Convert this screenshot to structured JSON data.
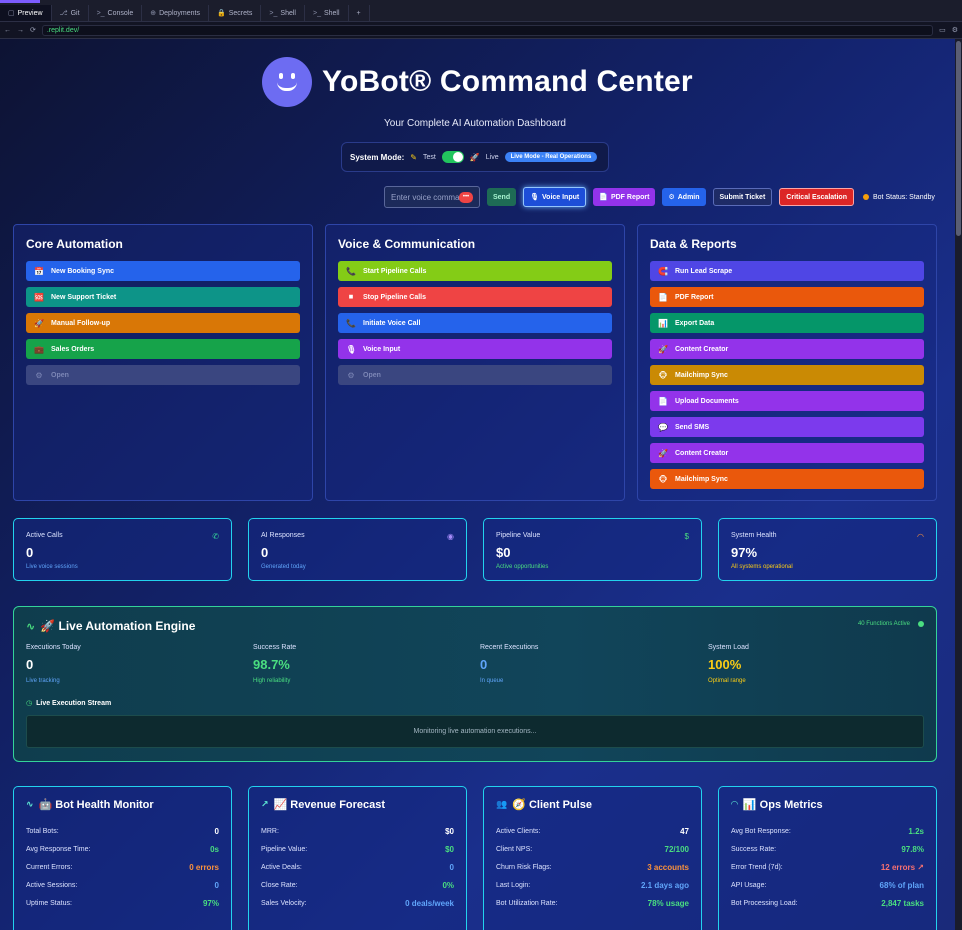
{
  "browser": {
    "tabs": [
      {
        "icon": "▢",
        "label": "Preview"
      },
      {
        "icon": "⎇",
        "label": "Git"
      },
      {
        "icon": ">_",
        "label": "Console"
      },
      {
        "icon": "⊕",
        "label": "Deployments"
      },
      {
        "icon": "🔒",
        "label": "Secrets"
      },
      {
        "icon": ">_",
        "label": "Shell"
      },
      {
        "icon": ">_",
        "label": "Shell"
      }
    ],
    "new_tab": "+",
    "url": ".replit.dev/"
  },
  "header": {
    "title": "YoBot® Command Center",
    "subtitle": "Your Complete AI Automation Dashboard"
  },
  "mode": {
    "label": "System Mode:",
    "test": "Test",
    "live": "Live",
    "badge": "Live Mode - Real Operations"
  },
  "toolbar": {
    "voice_placeholder": "Enter voice comma...",
    "send": "Send",
    "voice_input": "Voice Input",
    "pdf": "PDF Report",
    "admin": "Admin",
    "ticket": "Submit Ticket",
    "critical": "Critical Escalation",
    "bot_status": "Bot Status: Standby"
  },
  "panels": {
    "core": {
      "title": "Core Automation",
      "items": [
        {
          "label": "New Booking Sync",
          "icon": "📅",
          "color": "#2563eb"
        },
        {
          "label": "New Support Ticket",
          "icon": "🆘",
          "color": "#0d9488"
        },
        {
          "label": "Manual Follow-up",
          "icon": "🚀",
          "color": "#d97706"
        },
        {
          "label": "Sales Orders",
          "icon": "💼",
          "color": "#16a34a"
        },
        {
          "label": "Open",
          "icon": "⚙",
          "color": "dim"
        }
      ]
    },
    "voice": {
      "title": "Voice & Communication",
      "items": [
        {
          "label": "Start Pipeline Calls",
          "icon": "📞",
          "color": "#84cc16"
        },
        {
          "label": "Stop Pipeline Calls",
          "icon": "⏹",
          "color": "#ef4444"
        },
        {
          "label": "Initiate Voice Call",
          "icon": "📞",
          "color": "#2563eb"
        },
        {
          "label": "Voice Input",
          "icon": "🎙",
          "color": "#9333ea"
        },
        {
          "label": "Open",
          "icon": "⚙",
          "color": "dim"
        }
      ]
    },
    "data": {
      "title": "Data & Reports",
      "items": [
        {
          "label": "Run Lead Scrape",
          "icon": "🧲",
          "color": "#4f46e5"
        },
        {
          "label": "PDF Report",
          "icon": "📄",
          "color": "#ea580c"
        },
        {
          "label": "Export Data",
          "icon": "📊",
          "color": "#059669"
        },
        {
          "label": "Content Creator",
          "icon": "🚀",
          "color": "#9333ea"
        },
        {
          "label": "Mailchimp Sync",
          "icon": "🐵",
          "color": "#ca8a04"
        },
        {
          "label": "Upload Documents",
          "icon": "📄",
          "color": "#9333ea"
        },
        {
          "label": "Send SMS",
          "icon": "💬",
          "color": "#7c3aed"
        },
        {
          "label": "Content Creator",
          "icon": "🚀",
          "color": "#9333ea"
        },
        {
          "label": "Mailchimp Sync",
          "icon": "🐵",
          "color": "#ea580c"
        }
      ]
    }
  },
  "stats": [
    {
      "label": "Active Calls",
      "value": "0",
      "sub": "Live voice sessions",
      "icon": "phone-icon",
      "glyph": "✆",
      "sub_color": "#60a5fa",
      "icon_color": "#34d399"
    },
    {
      "label": "AI Responses",
      "value": "0",
      "sub": "Generated today",
      "icon": "brain-icon",
      "glyph": "◉",
      "sub_color": "#60a5fa",
      "icon_color": "#a78bfa"
    },
    {
      "label": "Pipeline Value",
      "value": "$0",
      "sub": "Active opportunities",
      "icon": "dollar-icon",
      "glyph": "$",
      "sub_color": "#4ade80",
      "icon_color": "#4ade80"
    },
    {
      "label": "System Health",
      "value": "97%",
      "sub": "All systems operational",
      "icon": "gauge-icon",
      "glyph": "◠",
      "sub_color": "#facc15",
      "icon_color": "#fb923c"
    }
  ],
  "engine": {
    "title": "🚀 Live Automation Engine",
    "active": "40 Functions Active",
    "metrics": [
      {
        "label": "Executions Today",
        "value": "0",
        "sub": "Live tracking",
        "color": "#ffffff",
        "sub_color": "#60a5fa"
      },
      {
        "label": "Success Rate",
        "value": "98.7%",
        "sub": "High reliability",
        "color": "#4ade80",
        "sub_color": "#4ade80"
      },
      {
        "label": "Recent Executions",
        "value": "0",
        "sub": "In queue",
        "color": "#60a5fa",
        "sub_color": "#60a5fa"
      },
      {
        "label": "System Load",
        "value": "100%",
        "sub": "Optimal range",
        "color": "#facc15",
        "sub_color": "#facc15"
      }
    ],
    "stream_title": "Live Execution Stream",
    "stream_text": "Monitoring live automation executions..."
  },
  "cards": [
    {
      "title": "🤖 Bot Health Monitor",
      "icon": "activity-icon",
      "glyph": "∿",
      "rows": [
        {
          "k": "Total Bots:",
          "v": "0",
          "c": "#ffffff"
        },
        {
          "k": "Avg Response Time:",
          "v": "0s",
          "c": "#4ade80"
        },
        {
          "k": "Current Errors:",
          "v": "0 errors",
          "c": "#fb923c"
        },
        {
          "k": "Active Sessions:",
          "v": "0",
          "c": "#60a5fa"
        },
        {
          "k": "Uptime Status:",
          "v": "97%",
          "c": "#4ade80"
        }
      ]
    },
    {
      "title": "📈 Revenue Forecast",
      "icon": "trend-icon",
      "glyph": "↗",
      "rows": [
        {
          "k": "MRR:",
          "v": "$0",
          "c": "#ffffff"
        },
        {
          "k": "Pipeline Value:",
          "v": "$0",
          "c": "#4ade80"
        },
        {
          "k": "Active Deals:",
          "v": "0",
          "c": "#60a5fa"
        },
        {
          "k": "Close Rate:",
          "v": "0%",
          "c": "#4ade80"
        },
        {
          "k": "Sales Velocity:",
          "v": "0 deals/week",
          "c": "#60a5fa"
        }
      ]
    },
    {
      "title": "🧭 Client Pulse",
      "icon": "users-icon",
      "glyph": "👥",
      "rows": [
        {
          "k": "Active Clients:",
          "v": "47",
          "c": "#ffffff"
        },
        {
          "k": "Client NPS:",
          "v": "72/100",
          "c": "#4ade80"
        },
        {
          "k": "Churn Risk Flags:",
          "v": "3 accounts",
          "c": "#fb923c"
        },
        {
          "k": "Last Login:",
          "v": "2.1 days ago",
          "c": "#60a5fa"
        },
        {
          "k": "Bot Utilization Rate:",
          "v": "78% usage",
          "c": "#4ade80"
        }
      ]
    },
    {
      "title": "📊 Ops Metrics",
      "icon": "gauge-icon",
      "glyph": "◠",
      "rows": [
        {
          "k": "Avg Bot Response:",
          "v": "1.2s",
          "c": "#4ade80"
        },
        {
          "k": "Success Rate:",
          "v": "97.8%",
          "c": "#4ade80"
        },
        {
          "k": "Error Trend (7d):",
          "v": "12 errors ↗",
          "c": "#f87171"
        },
        {
          "k": "API Usage:",
          "v": "68% of plan",
          "c": "#60a5fa"
        },
        {
          "k": "Bot Processing Load:",
          "v": "2,847 tasks",
          "c": "#4ade80"
        }
      ]
    }
  ]
}
